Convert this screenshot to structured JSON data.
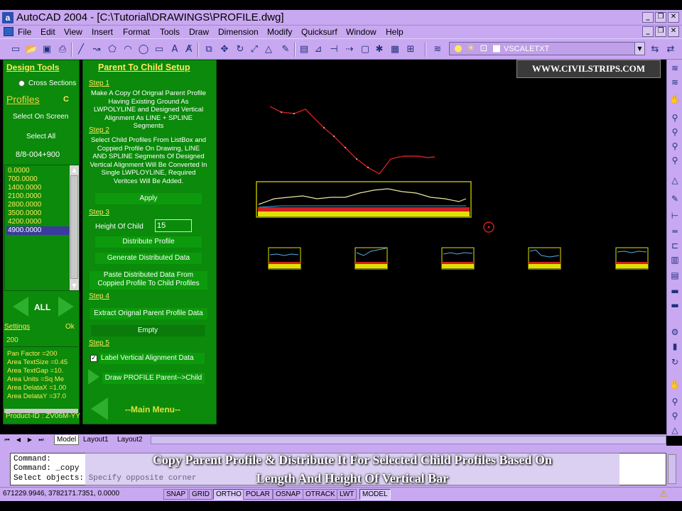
{
  "window": {
    "title": "AutoCAD 2004 - [C:\\Tutorial\\DRAWINGS\\PROFILE.dwg]",
    "app_icon": "autocad-a-icon"
  },
  "menu": [
    "File",
    "Edit",
    "View",
    "Insert",
    "Format",
    "Tools",
    "Draw",
    "Dimension",
    "Modify",
    "Quicksurf",
    "Window",
    "Help"
  ],
  "toolbar": {
    "layer_name": "VSCALETXT"
  },
  "design_tools": {
    "title": "Design Tools",
    "cross_sections_label": "Cross Sections",
    "profiles_label": "Profiles",
    "profiles_letter": "C",
    "select_on_screen": "Select On Screen",
    "select_all": "Select All",
    "profile_id": "8/8-004+900",
    "chainages": [
      "0.0000",
      "700.0000",
      "1400.0000",
      "2100.0000",
      "2800.0000",
      "3500.0000",
      "4200.0000",
      "4900.0000"
    ],
    "selected_chainage": "4900.0000",
    "all_label": "ALL",
    "settings_label": "Settings",
    "ok_label": "Ok",
    "settings_value": "200",
    "settings_list": [
      "Pan Factor   =200",
      "Area TextSize =0.45",
      "Area TextGap  =10.",
      "Area Units    =Sq Me",
      "Area DelataX =1.00",
      "Area DelataY =37.0"
    ],
    "product_id": "Product-ID : ZV06M-YY"
  },
  "setup": {
    "title": "Parent To Child Setup",
    "step1_label": "Step 1",
    "step1_text": "Make A Copy Of Orignal Parent Profile Having Existing Ground As LWPOLYLINE and Designed Vertical Alignment As LINE + SPLINE Segments",
    "step2_label": "Step 2",
    "step2_text": "Select Child Profiles From ListBox and Coppied Profile On Drawing, LINE AND SPLINE Segments Of Designed Vertical Alignment Will Be Converted In Single LWPLOYLINE, Required Veritces Will Be Added.",
    "apply": "Apply",
    "step3_label": "Step 3",
    "height_label": "Height Of Child",
    "height_value": "15",
    "distribute_profile": "Distribute Profile",
    "generate_distributed": "Generate Distributed Data",
    "paste_distributed": "Paste Distributed Data From Coppied Profile To Child Profiles",
    "step4_label": "Step 4",
    "extract_parent": "Extract Orignal Parent Profile Data",
    "empty": "Empty",
    "step5_label": "Step 5",
    "label_vertical": "Label Vertical Alignment Data",
    "label_vertical_checked": true,
    "draw_profile": "Draw PROFILE Parent-->Child",
    "main_menu": "--Main Menu--"
  },
  "canvas": {
    "watermark": "WWW.CIVILSTRIPS.COM"
  },
  "tabs": [
    "Model",
    "Layout1",
    "Layout2"
  ],
  "active_tab": "Model",
  "command_lines": [
    "Command:",
    "Command: _copy",
    "Select objects: Specify opposite corner"
  ],
  "caption": {
    "line1": "Copy Parent Profile & Distribute It For Selected Child Profiles Based On",
    "line2": "Length And Height Of Vertical Bar"
  },
  "status": {
    "coords": "671229.9946, 3782171.7351, 0.0000",
    "buttons": [
      "SNAP",
      "GRID",
      "ORTHO",
      "POLAR",
      "OSNAP",
      "OTRACK",
      "LWT",
      "MODEL"
    ],
    "pressed": [
      "ORTHO",
      "MODEL"
    ]
  },
  "colors": {
    "panel_green": "#0b8a0b",
    "link_yellow": "#ffe85c",
    "chrome_purple": "#c8a8f0",
    "profile_red": "#d02020",
    "profile_box_yellow": "#e0e000"
  }
}
